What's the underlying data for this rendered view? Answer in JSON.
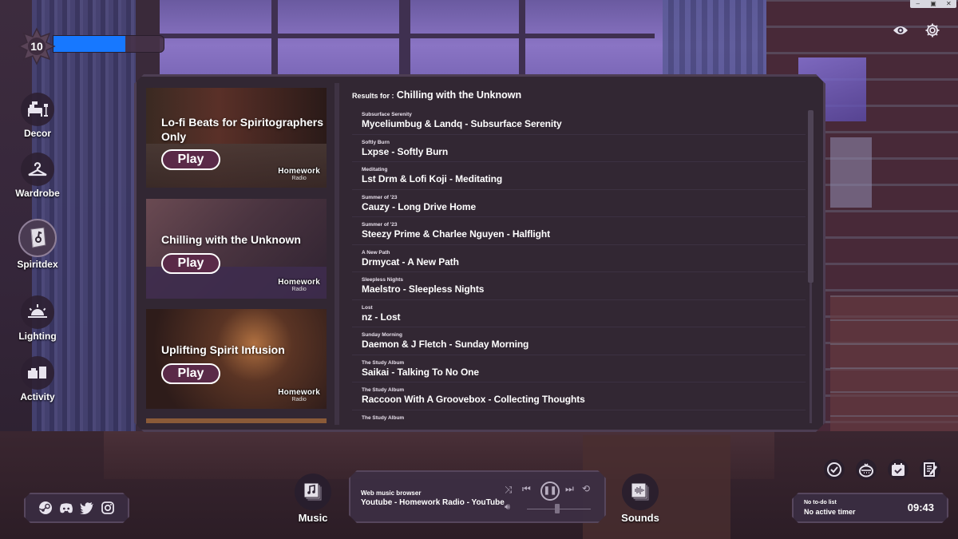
{
  "window_controls": {
    "minimize": "–",
    "restore": "▣",
    "close": "✕"
  },
  "top_icons": {
    "visibility": "visibility-icon",
    "settings": "settings-icon"
  },
  "player_level": {
    "level": "10",
    "xp_progress_percent": 65,
    "xp_color": "#1778ff"
  },
  "sidebar": {
    "items": [
      {
        "label": "Decor",
        "icon": "bed-lamp-icon",
        "active": false
      },
      {
        "label": "Wardrobe",
        "icon": "hanger-icon",
        "active": false
      },
      {
        "label": "Spiritdex",
        "icon": "spirit-book-icon",
        "active": true
      },
      {
        "label": "Lighting",
        "icon": "sunrise-icon",
        "active": false
      },
      {
        "label": "Activity",
        "icon": "activity-icon",
        "active": false
      }
    ]
  },
  "music_panel": {
    "playlists": [
      {
        "title": "Lo-fi Beats for Spiritographers Only",
        "play_label": "Play",
        "logo_line1": "Homework",
        "logo_line2": "Radio"
      },
      {
        "title": "Chilling with the Unknown",
        "play_label": "Play",
        "logo_line1": "Homework",
        "logo_line2": "Radio"
      },
      {
        "title": "Uplifting Spirit Infusion",
        "play_label": "Play",
        "logo_line1": "Homework",
        "logo_line2": "Radio"
      }
    ],
    "results_label": "Results for :",
    "results_query": "Chilling with the Unknown",
    "tracks": [
      {
        "album": "Subsurface Serenity",
        "title": "Myceliumbug & Landq - Subsurface Serenity"
      },
      {
        "album": "Softly Burn",
        "title": "Lxpse - Softly Burn"
      },
      {
        "album": "Meditating",
        "title": "Lst Drm & Lofi Koji - Meditating"
      },
      {
        "album": "Summer of '23",
        "title": "Cauzy - Long Drive Home"
      },
      {
        "album": "Summer of '23",
        "title": "Steezy Prime & Charlee Nguyen - Halflight"
      },
      {
        "album": "A New Path",
        "title": "Drmycat - A New Path"
      },
      {
        "album": "Sleepless Nights",
        "title": "Maelstro - Sleepless Nights"
      },
      {
        "album": "Lost",
        "title": "nz - Lost"
      },
      {
        "album": "Sunday Morning",
        "title": "Daemon & J Fletch - Sunday Morning"
      },
      {
        "album": "The Study Album",
        "title": "Saikai - Talking To No One"
      },
      {
        "album": "The Study Album",
        "title": "Raccoon With A Groovebox - Collecting Thoughts"
      },
      {
        "album": "The Study Album",
        "title": ""
      }
    ],
    "scroll_visible_fraction": 0.55,
    "scroll_position_fraction": 0
  },
  "bottom_bar": {
    "social_icons": [
      "steam-icon",
      "discord-icon",
      "twitter-icon",
      "instagram-icon"
    ],
    "music_label": "Music",
    "sounds_label": "Sounds",
    "player": {
      "source": "Web music browser",
      "now_playing": "Youtube - Homework Radio - YouTube",
      "state": "playing",
      "volume_percent": 48
    },
    "tools": [
      "check-icon",
      "pomodoro-timer-icon",
      "calendar-check-icon",
      "notepad-icon"
    ],
    "timer": {
      "todo": "No to-do list",
      "status": "No active timer",
      "clock": "09:43"
    }
  }
}
